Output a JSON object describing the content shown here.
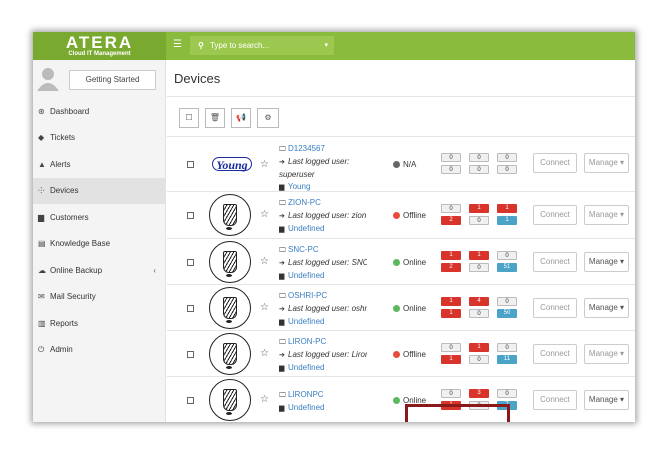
{
  "brand": {
    "name": "ATERA",
    "tagline": "Cloud IT Management"
  },
  "topbar": {
    "menu_icon": "☰",
    "search_placeholder": "Type to search..."
  },
  "sidebar": {
    "getting_started": "Getting Started",
    "items": [
      {
        "label": "Dashboard",
        "icon": "dashboard-icon",
        "glyph": "⊛"
      },
      {
        "label": "Tickets",
        "icon": "tag-icon",
        "glyph": "◆"
      },
      {
        "label": "Alerts",
        "icon": "warning-icon",
        "glyph": "▲"
      },
      {
        "label": "Devices",
        "icon": "sitemap-icon",
        "glyph": "⸭"
      },
      {
        "label": "Customers",
        "icon": "briefcase-icon",
        "glyph": "▆"
      },
      {
        "label": "Knowledge Base",
        "icon": "book-icon",
        "glyph": "▤"
      },
      {
        "label": "Online Backup",
        "icon": "cloud-upload-icon",
        "glyph": "☁"
      },
      {
        "label": "Mail Security",
        "icon": "envelope-icon",
        "glyph": "✉"
      },
      {
        "label": "Reports",
        "icon": "bar-chart-icon",
        "glyph": "▥"
      },
      {
        "label": "Admin",
        "icon": "power-icon",
        "glyph": "⏻"
      }
    ],
    "chevron": "‹"
  },
  "page": {
    "title": "Devices"
  },
  "toolbar": {
    "icons": [
      "checkbox-icon",
      "trash-icon",
      "megaphone-icon",
      "agent-settings-icon"
    ]
  },
  "rows": [
    {
      "name": "D1234567",
      "last_user_prefix": "Last logged user:",
      "last_user": "superuser",
      "customer": "Young",
      "status": "N/A",
      "b": {
        "r1": [
          "0",
          "0",
          "0"
        ],
        "r2": [
          "0",
          "0",
          "0"
        ]
      },
      "connect": "Connect",
      "manage": "Manage ▾"
    },
    {
      "name": "ZION-PC",
      "last_user_prefix": "Last logged user:",
      "last_user": "zion",
      "customer": "Undefined",
      "status": "Offline",
      "b": {
        "r1": [
          "0",
          "1",
          "1"
        ],
        "r2": [
          "2",
          "0",
          "1"
        ]
      },
      "connect": "Connect",
      "manage": "Manage ▾"
    },
    {
      "name": "SNC-PC",
      "last_user_prefix": "Last logged user:",
      "last_user": "SNC",
      "customer": "Undefined",
      "status": "Online",
      "b": {
        "r1": [
          "1",
          "1",
          "0"
        ],
        "r2": [
          "2",
          "0",
          "51"
        ]
      },
      "connect": "Connect",
      "manage": "Manage ▾"
    },
    {
      "name": "OSHRI-PC",
      "last_user_prefix": "Last logged user:",
      "last_user": "oshri",
      "customer": "Undefined",
      "status": "Online",
      "b": {
        "r1": [
          "1",
          "4",
          "0"
        ],
        "r2": [
          "1",
          "0",
          "50"
        ]
      },
      "connect": "Connect",
      "manage": "Manage ▾"
    },
    {
      "name": "LIRON-PC",
      "last_user_prefix": "Last logged user:",
      "last_user": "Liron",
      "customer": "Undefined",
      "status": "Offline",
      "b": {
        "r1": [
          "0",
          "1",
          "0"
        ],
        "r2": [
          "1",
          "0",
          "11"
        ]
      },
      "connect": "Connect",
      "manage": "Manage ▾"
    },
    {
      "name": "LIRONPC",
      "customer": "Undefined",
      "status": "Online",
      "b": {
        "r1": [
          "0",
          "3",
          "0"
        ],
        "r2": [
          "1",
          "0",
          "7"
        ]
      },
      "connect": "Connect",
      "manage": "Manage ▾"
    }
  ],
  "colors": {
    "green": "#8bbb3c",
    "online": "#5cb85c",
    "offline": "#e74c3c",
    "na": "#666666",
    "red_badge": "#d9342b",
    "teal_badge": "#4ba3c7",
    "highlight": "#8a1a1a"
  }
}
